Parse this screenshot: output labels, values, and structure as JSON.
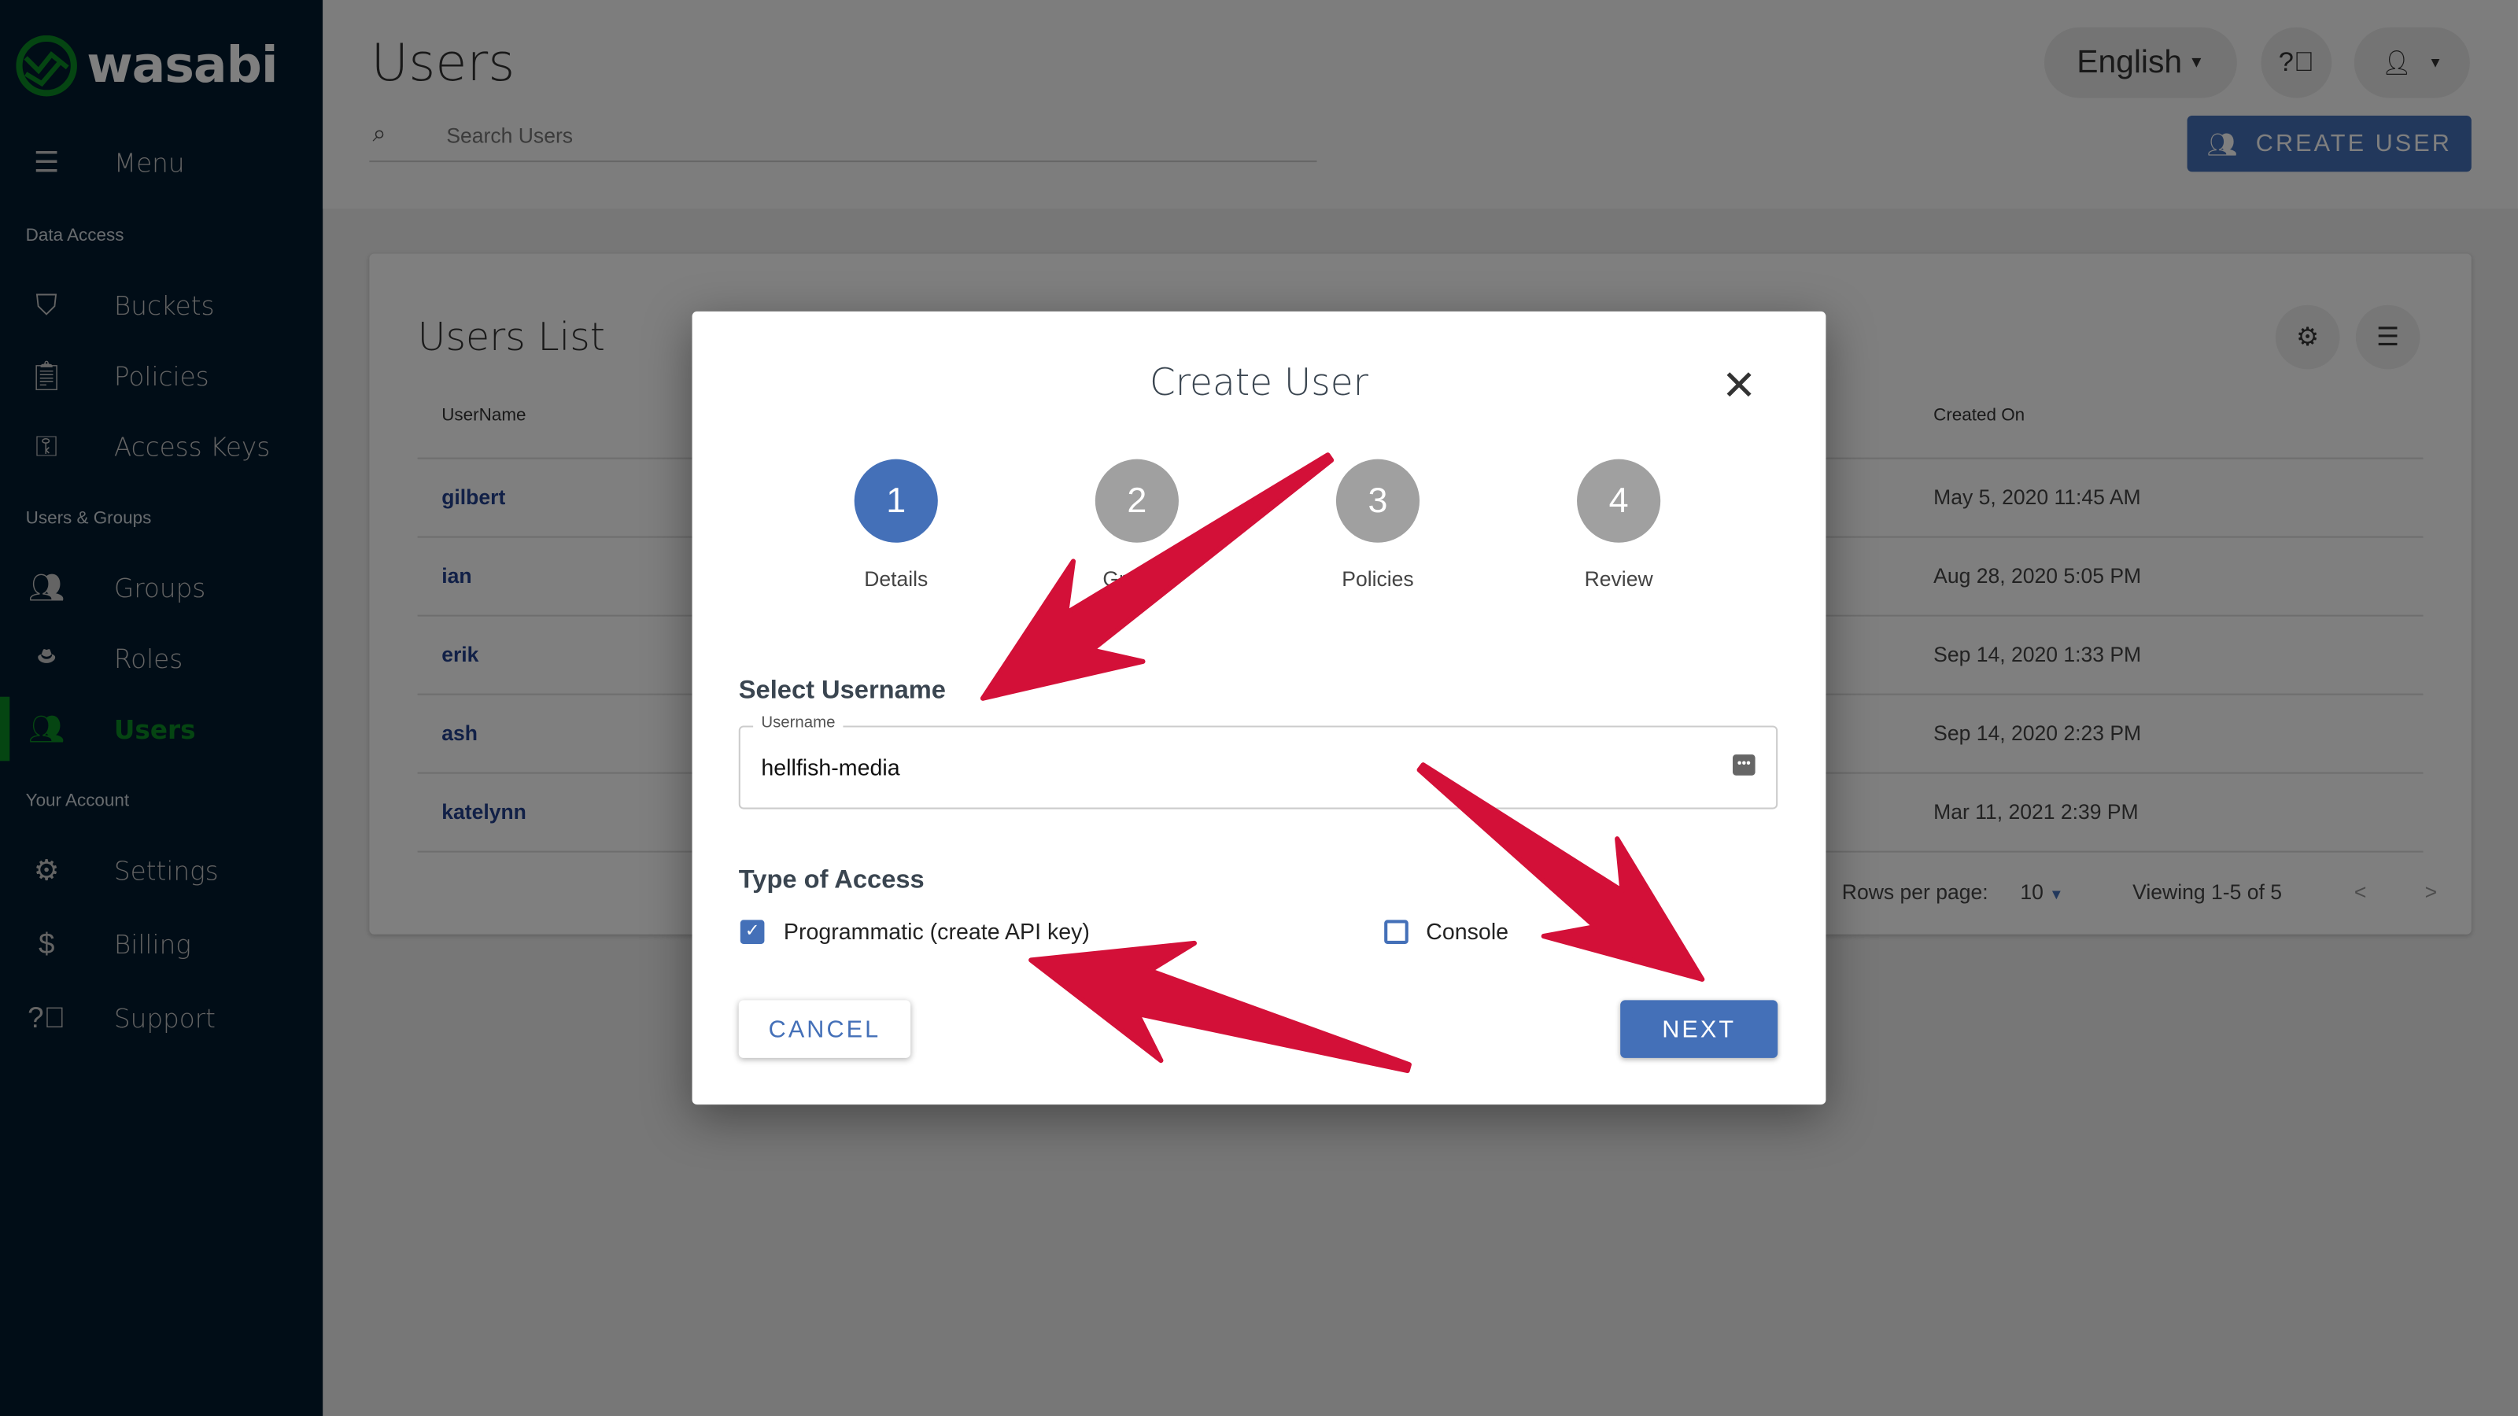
{
  "brand": {
    "name": "wasabi",
    "logo_color": "#0a8a24"
  },
  "sidebar": {
    "menu_label": "Menu",
    "sections": [
      {
        "title": "Data Access",
        "items": [
          {
            "label": "Buckets",
            "icon": "bucket-icon"
          },
          {
            "label": "Policies",
            "icon": "clipboard-icon"
          },
          {
            "label": "Access Keys",
            "icon": "key-icon"
          }
        ]
      },
      {
        "title": "Users & Groups",
        "items": [
          {
            "label": "Groups",
            "icon": "groups-icon"
          },
          {
            "label": "Roles",
            "icon": "hat-icon"
          },
          {
            "label": "Users",
            "icon": "users-icon",
            "active": true
          }
        ]
      },
      {
        "title": "Your Account",
        "items": [
          {
            "label": "Settings",
            "icon": "gear-icon"
          },
          {
            "label": "Billing",
            "icon": "dollar-icon"
          },
          {
            "label": "Support",
            "icon": "help-icon"
          }
        ]
      }
    ]
  },
  "header": {
    "title": "Users",
    "search_placeholder": "Search Users",
    "language": "English",
    "create_user_label": "CREATE USER"
  },
  "users_list": {
    "title": "Users List",
    "columns": [
      "UserName",
      "Created On"
    ],
    "rows": [
      {
        "username": "gilbert",
        "created": "May 5, 2020 11:45 AM"
      },
      {
        "username": "ian",
        "created": "Aug 28, 2020 5:05 PM"
      },
      {
        "username": "erik",
        "created": "Sep 14, 2020 1:33 PM"
      },
      {
        "username": "ash",
        "created": "Sep 14, 2020 2:23 PM"
      },
      {
        "username": "katelynn",
        "created": "Mar 11, 2021 2:39 PM"
      }
    ],
    "rows_per_page_label": "Rows per page:",
    "rows_per_page": "10",
    "viewing": "Viewing 1-5 of 5"
  },
  "modal": {
    "title": "Create User",
    "steps": [
      {
        "num": "1",
        "label": "Details",
        "active": true
      },
      {
        "num": "2",
        "label": "Groups"
      },
      {
        "num": "3",
        "label": "Policies"
      },
      {
        "num": "4",
        "label": "Review"
      }
    ],
    "select_username": "Select Username",
    "username_label": "Username",
    "username_value": "hellfish-media",
    "type_of_access": "Type of Access",
    "programmatic_label": "Programmatic (create API key)",
    "programmatic_checked": true,
    "console_label": "Console",
    "console_checked": false,
    "cancel_label": "CANCEL",
    "next_label": "NEXT"
  },
  "colors": {
    "accent": "#4470b8",
    "arrow": "#d31038",
    "sidebar_bg": "#031a2e",
    "active_green": "#0a8a24"
  }
}
